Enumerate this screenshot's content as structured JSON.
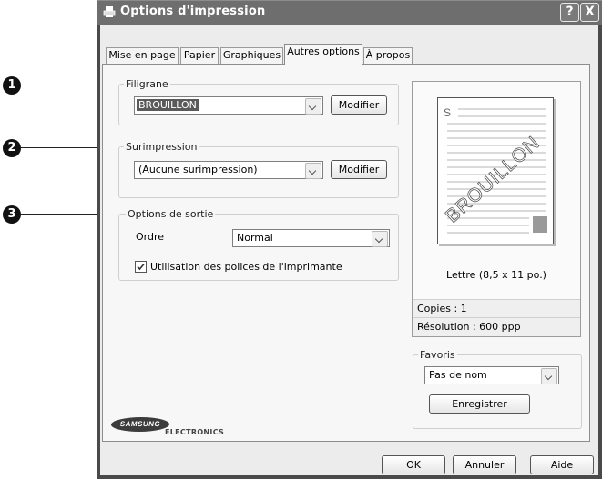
{
  "window": {
    "title": "Options d'impression",
    "help_button": "?",
    "close_button": "X"
  },
  "tabs": [
    {
      "label": "Mise en page",
      "active": false
    },
    {
      "label": "Papier",
      "active": false
    },
    {
      "label": "Graphiques",
      "active": false
    },
    {
      "label": "Autres options",
      "active": true
    },
    {
      "label": "À propos",
      "active": false
    }
  ],
  "callouts": [
    "1",
    "2",
    "3"
  ],
  "watermark": {
    "group_label": "Filigrane",
    "selected": "BROUILLON",
    "modify_label": "Modifier"
  },
  "overlay": {
    "group_label": "Surimpression",
    "selected": "(Aucune surimpression)",
    "modify_label": "Modifier"
  },
  "output": {
    "group_label": "Options de sortie",
    "order_label": "Ordre",
    "order_value": "Normal",
    "printer_fonts_label": "Utilisation des polices de l'imprimante",
    "printer_fonts_checked": true
  },
  "preview": {
    "corner_letter": "S",
    "watermark_text": "BROUILLON",
    "paper_size": "Lettre (8,5 x 11 po.)",
    "copies": "Copies : 1",
    "resolution": "Résolution : 600 ppp"
  },
  "favorites": {
    "group_label": "Favoris",
    "selected": "Pas de nom",
    "save_label": "Enregistrer"
  },
  "logo": {
    "brand": "SAMSUNG",
    "sub": "ELECTRONICS"
  },
  "footer": {
    "ok": "OK",
    "cancel": "Annuler",
    "help": "Aide"
  }
}
